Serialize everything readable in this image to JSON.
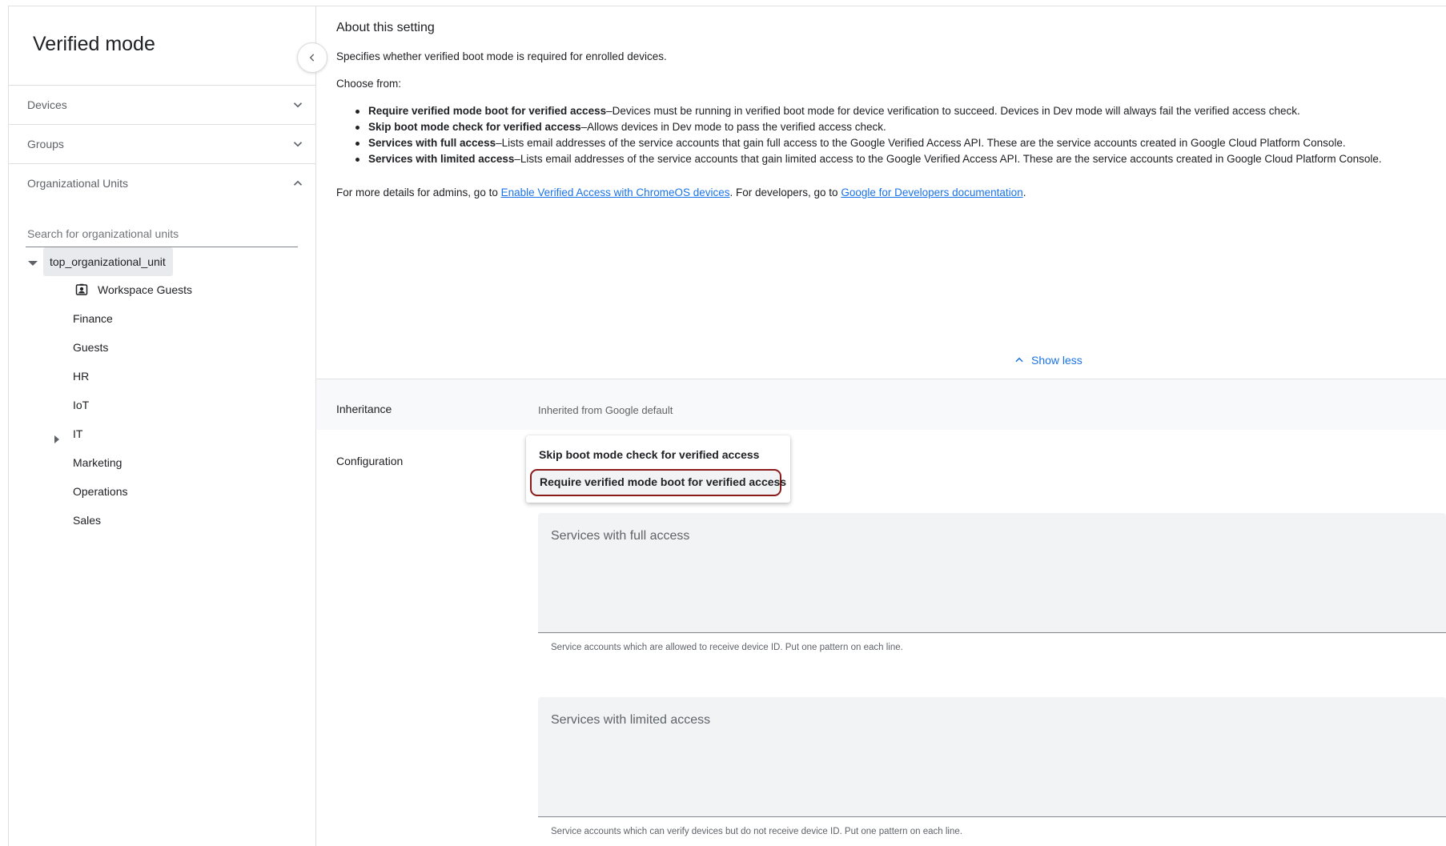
{
  "sidebar": {
    "title": "Verified mode",
    "sections": [
      {
        "label": "Devices",
        "expanded": false
      },
      {
        "label": "Groups",
        "expanded": false
      },
      {
        "label": "Organizational Units",
        "expanded": true
      }
    ],
    "search_placeholder": "Search for organizational units",
    "tree": {
      "root": "top_organizational_unit",
      "children": [
        "Workspace Guests",
        "Finance",
        "Guests",
        "HR",
        "IoT",
        "IT",
        "Marketing",
        "Operations",
        "Sales"
      ]
    }
  },
  "about": {
    "title": "About this setting",
    "description": "Specifies whether verified boot mode is required for enrolled devices.",
    "choose_from": "Choose from:",
    "bullets": [
      {
        "term": "Require verified mode boot for verified access",
        "text": "–Devices must be running in verified boot mode for device verification to succeed. Devices in Dev mode will always fail the verified access check."
      },
      {
        "term": "Skip boot mode check for verified access",
        "text": "–Allows devices in Dev mode to pass the verified access check."
      },
      {
        "term": "Services with full access",
        "text": "–Lists email addresses of the service accounts that gain full access to the Google Verified Access API. These are the service accounts created in Google Cloud Platform Console."
      },
      {
        "term": "Services with limited access",
        "text": "–Lists email addresses of the service accounts that gain limited access to the Google Verified Access API. These are the service accounts created in Google Cloud Platform Console."
      }
    ],
    "details_prefix": "For more details for admins, go to ",
    "details_link1": "Enable Verified Access with ChromeOS devices",
    "details_middle": ". For developers, go to ",
    "details_link2": "Google for Developers documentation",
    "details_suffix": ".",
    "show_less": "Show less"
  },
  "inheritance": {
    "label": "Inheritance",
    "value": "Inherited from Google default"
  },
  "configuration": {
    "label": "Configuration",
    "options": [
      "Skip boot mode check for verified access",
      "Require verified mode boot for verified access"
    ],
    "selected": "Require verified mode boot for verified access"
  },
  "full_access": {
    "placeholder": "Services with full access",
    "helper": "Service accounts which are allowed to receive device ID. Put one pattern on each line."
  },
  "limited_access": {
    "placeholder": "Services with limited access",
    "helper": "Service accounts which can verify devices but do not receive device ID. Put one pattern on each line."
  },
  "colors": {
    "link": "#1a73e8",
    "highlight_border": "#8b1a1a",
    "field_bg": "#f1f3f4"
  }
}
